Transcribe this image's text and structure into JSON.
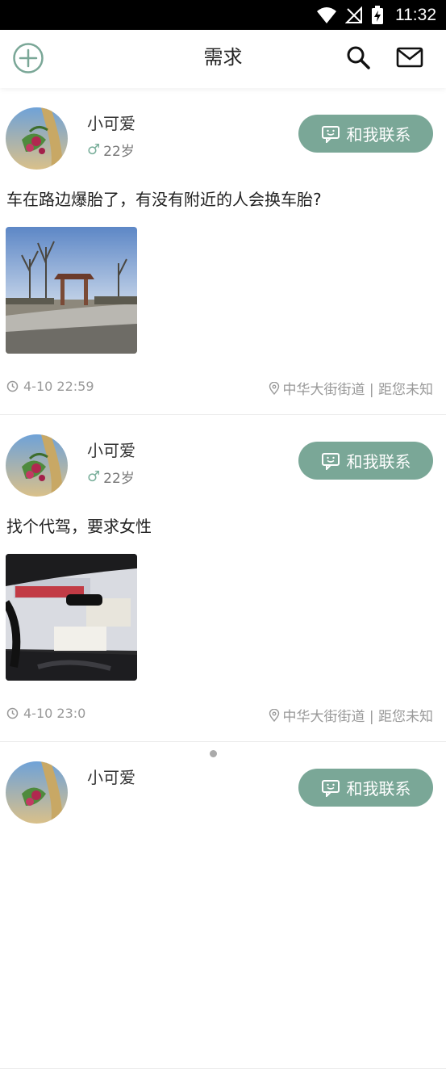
{
  "statusbar": {
    "time": "11:32"
  },
  "header": {
    "title": "需求"
  },
  "colors": {
    "accent": "#7aa797",
    "gender_icon": "#7aaf9b",
    "muted": "#999999"
  },
  "posts": [
    {
      "name": "小可爱",
      "gender_symbol": "♂",
      "age": "22岁",
      "contact_label": "和我联系",
      "content": "车在路边爆胎了，有没有附近的人会换车胎?",
      "time": "4-10 22:59",
      "location": "中华大街街道 | 距您未知"
    },
    {
      "name": "小可爱",
      "gender_symbol": "♂",
      "age": "22岁",
      "contact_label": "和我联系",
      "content": "找个代驾，要求女性",
      "time": "4-10 23:0",
      "location": "中华大街街道 | 距您未知"
    },
    {
      "name": "小可爱",
      "contact_label": "和我联系"
    }
  ]
}
